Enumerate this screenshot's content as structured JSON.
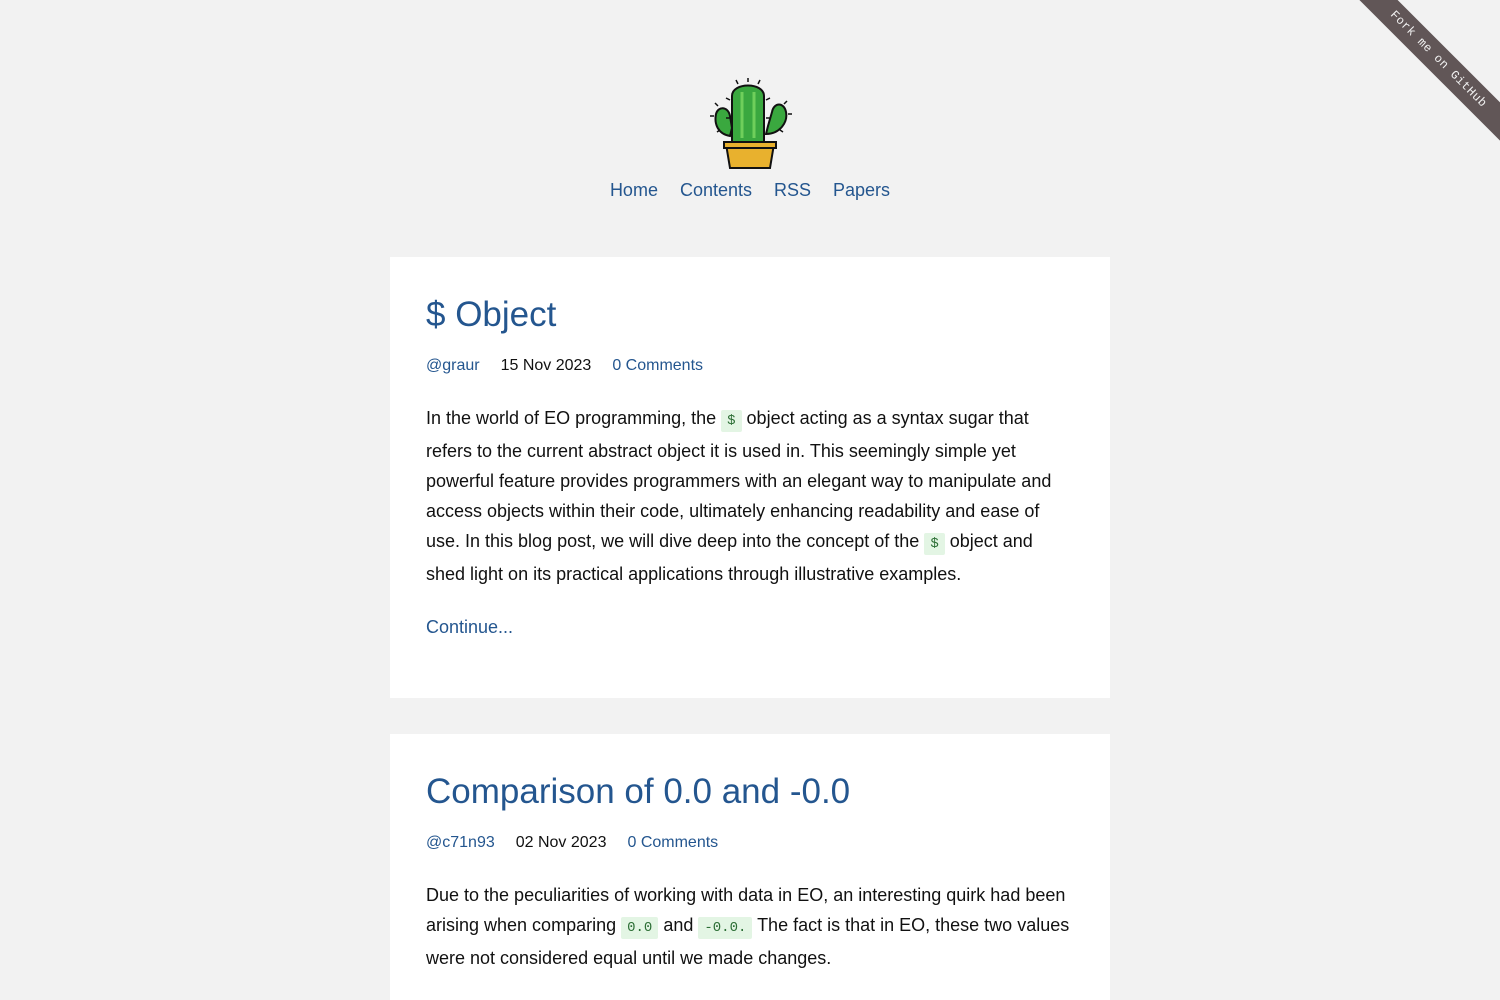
{
  "ribbon": {
    "label": "Fork me on GitHub"
  },
  "nav": {
    "items": [
      {
        "label": "Home"
      },
      {
        "label": "Contents"
      },
      {
        "label": "RSS"
      },
      {
        "label": "Papers"
      }
    ]
  },
  "posts": [
    {
      "title": "$ Object",
      "author": "@graur",
      "date": "15 Nov 2023",
      "comments": "0 Comments",
      "excerpt": {
        "t1": "In the world of EO programming, the ",
        "c1": "$",
        "t2": " object acting as a syntax sugar that refers to the current abstract object it is used in. This seemingly simple yet powerful feature provides programmers with an elegant way to manipulate and access objects within their code, ultimately enhancing readability and ease of use. In this blog post, we will dive deep into the concept of the ",
        "c2": "$",
        "t3": " object and shed light on its practical applications through illustrative examples."
      },
      "continue_label": "Continue..."
    },
    {
      "title": "Comparison of 0.0 and -0.0",
      "author": "@c71n93",
      "date": "02 Nov 2023",
      "comments": "0 Comments",
      "excerpt": {
        "t1": "Due to the peculiarities of working with data in EO, an interesting quirk had been arising when comparing ",
        "c1": "0.0",
        "t2": " and ",
        "c2": "-0.0.",
        "t3": " The fact is that in EO, these two values were not considered equal until we made changes."
      }
    }
  ],
  "colors": {
    "link": "#24568f",
    "background": "#f2f2f2",
    "code_bg": "#e3f5e4",
    "ribbon": "#615657"
  }
}
